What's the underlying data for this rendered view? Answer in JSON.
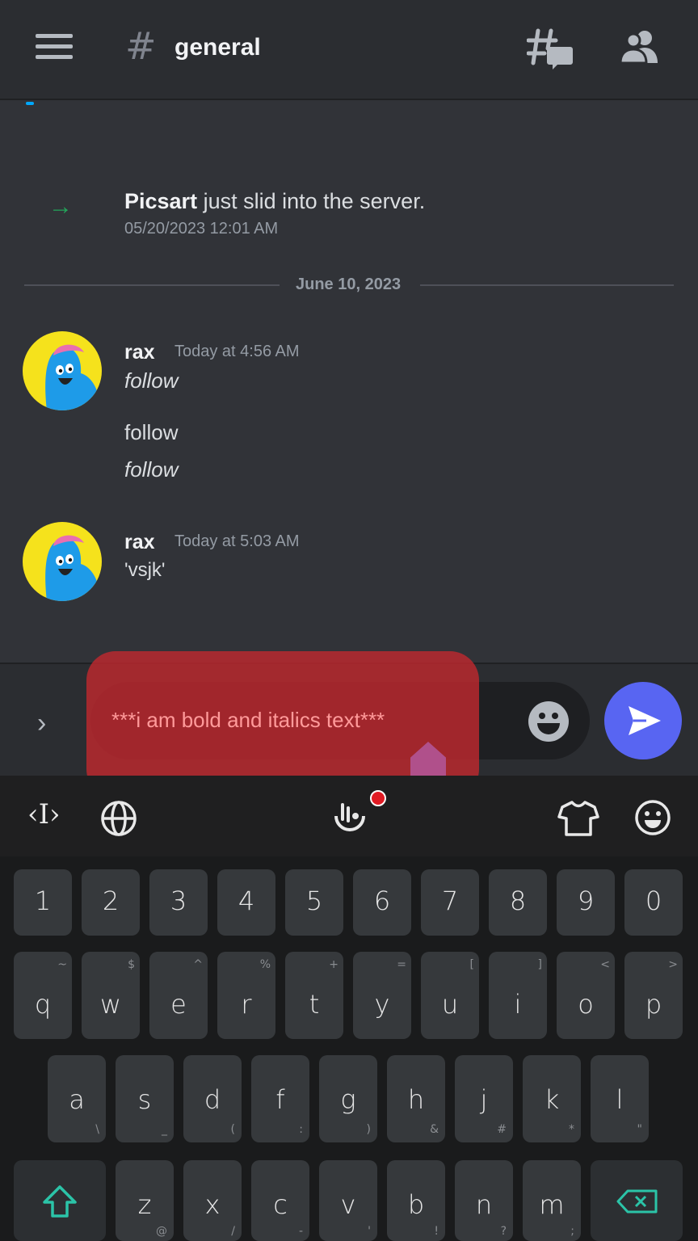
{
  "header": {
    "channel_hash": "#",
    "channel_name": "general"
  },
  "icons": {
    "menu": "hamburger-menu-icon",
    "threads": "threads-icon",
    "members": "members-icon",
    "join": "arrow-right-icon",
    "expand": "chevron-right-icon",
    "emoji": "emoji-icon",
    "send": "send-icon"
  },
  "system_message": {
    "arrow": "→",
    "username": "Picsart",
    "text": " just slid into the server.",
    "timestamp": "05/20/2023 12:01 AM"
  },
  "date_divider": "June 10, 2023",
  "messages": [
    {
      "username": "rax",
      "time": "Today at 4:56 AM",
      "lines": [
        "follow",
        "follow",
        "follow"
      ]
    },
    {
      "username": "rax",
      "time": "Today at 5:03 AM",
      "lines": [
        "'vsjk'"
      ]
    }
  ],
  "composer": {
    "chevron": "›",
    "text": "***i am bold and italics text***"
  },
  "keyboard_toolbar": {
    "cursor_glyph": "‹I›"
  },
  "keyboard": {
    "row_numbers": [
      "1",
      "2",
      "3",
      "4",
      "5",
      "6",
      "7",
      "8",
      "9",
      "0"
    ],
    "row_top": [
      {
        "main": "q",
        "sub": "~"
      },
      {
        "main": "w",
        "sub": "$"
      },
      {
        "main": "e",
        "sub": "^"
      },
      {
        "main": "r",
        "sub": "%"
      },
      {
        "main": "t",
        "sub": "+"
      },
      {
        "main": "y",
        "sub": "="
      },
      {
        "main": "u",
        "sub": "["
      },
      {
        "main": "i",
        "sub": "]"
      },
      {
        "main": "o",
        "sub": "<"
      },
      {
        "main": "p",
        "sub": ">"
      }
    ],
    "row_home": [
      {
        "main": "a",
        "sub": "\\"
      },
      {
        "main": "s",
        "sub": "_"
      },
      {
        "main": "d",
        "sub": "("
      },
      {
        "main": "f",
        "sub": ":"
      },
      {
        "main": "g",
        "sub": ")"
      },
      {
        "main": "h",
        "sub": "&"
      },
      {
        "main": "j",
        "sub": "#"
      },
      {
        "main": "k",
        "sub": "*"
      },
      {
        "main": "l",
        "sub": "\""
      }
    ],
    "row_bottom": [
      {
        "main": "z",
        "sub": "@"
      },
      {
        "main": "x",
        "sub": "/"
      },
      {
        "main": "c",
        "sub": "-"
      },
      {
        "main": "v",
        "sub": "'"
      },
      {
        "main": "b",
        "sub": "!"
      },
      {
        "main": "n",
        "sub": "?"
      },
      {
        "main": "m",
        "sub": ";"
      }
    ]
  },
  "colors": {
    "background": "#313338",
    "header": "#2b2d31",
    "send_button": "#5865f2",
    "join_arrow": "#23a55a",
    "avatar_bg": "#f5e21c",
    "shift_accent": "#2bc4a8",
    "overlay": "#be282e"
  }
}
